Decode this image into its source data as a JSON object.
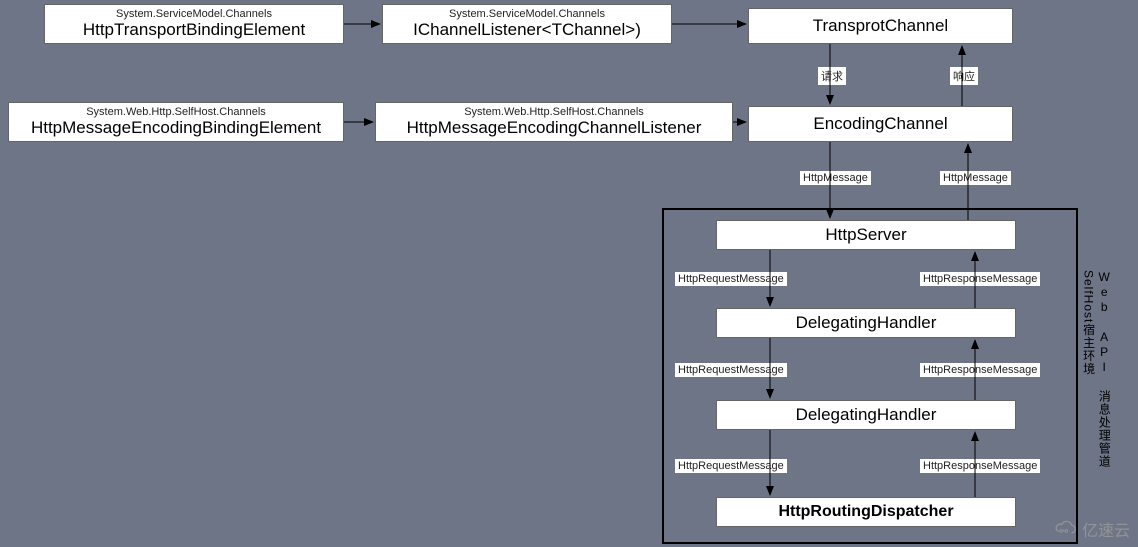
{
  "nodes": {
    "httpTransportBinding": {
      "ns": "System.ServiceModel.Channels",
      "title": "HttpTransportBindingElement"
    },
    "iChannelListener": {
      "ns": "System.ServiceModel.Channels",
      "title": "IChannelListener<TChannel>)"
    },
    "transportChannel": {
      "title": "TransprotChannel"
    },
    "httpMsgEncBinding": {
      "ns": "System.Web.Http.SelfHost.Channels",
      "title": "HttpMessageEncodingBindingElement"
    },
    "httpMsgEncListener": {
      "ns": "System.Web.Http.SelfHost.Channels",
      "title": "HttpMessageEncodingChannelListener"
    },
    "encodingChannel": {
      "title": "EncodingChannel"
    },
    "httpServer": {
      "title": "HttpServer"
    },
    "delegatingHandler1": {
      "title": "DelegatingHandler"
    },
    "delegatingHandler2": {
      "title": "DelegatingHandler"
    },
    "httpRoutingDispatcher": {
      "title": "HttpRoutingDispatcher"
    }
  },
  "labels": {
    "request": "请求",
    "response": "响应",
    "httpMessage1": "HttpMessage",
    "httpMessage2": "HttpMessage",
    "httpReq1": "HttpRequestMessage",
    "httpReq2": "HttpRequestMessage",
    "httpReq3": "HttpRequestMessage",
    "httpResp1": "HttpResponseMessage",
    "httpResp2": "HttpResponseMessage",
    "httpResp3": "HttpResponseMessage"
  },
  "pipelineCaption": {
    "line1": "Web API 消息处理管道",
    "line2": "SelfHost宿主环境"
  },
  "watermark": "亿速云"
}
